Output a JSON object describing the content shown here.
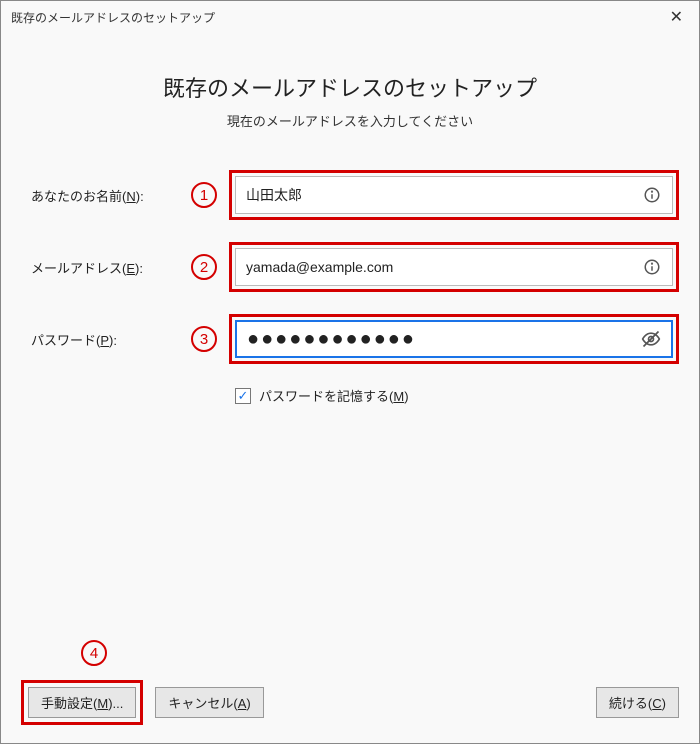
{
  "titlebar": {
    "title": "既存のメールアドレスのセットアップ"
  },
  "heading": "既存のメールアドレスのセットアップ",
  "subheading": "現在のメールアドレスを入力してください",
  "annotations": {
    "n1": "1",
    "n2": "2",
    "n3": "3",
    "n4": "4"
  },
  "labels": {
    "name_pre": "あなたのお名前(",
    "name_key": "N",
    "name_post": "):",
    "email_pre": "メールアドレス(",
    "email_key": "E",
    "email_post": "):",
    "password_pre": "パスワード(",
    "password_key": "P",
    "password_post": "):",
    "remember_pre": "パスワードを記憶する(",
    "remember_key": "M",
    "remember_post": ")"
  },
  "values": {
    "name": "山田太郎",
    "email": "yamada@example.com",
    "password_mask": "●●●●●●●●●●●●"
  },
  "checkbox": {
    "remember_checked": "✓"
  },
  "buttons": {
    "manual_pre": "手動設定(",
    "manual_key": "M",
    "manual_post": ")...",
    "cancel_pre": "キャンセル(",
    "cancel_key": "A",
    "cancel_post": ")",
    "continue_pre": "続ける(",
    "continue_key": "C",
    "continue_post": ")"
  }
}
